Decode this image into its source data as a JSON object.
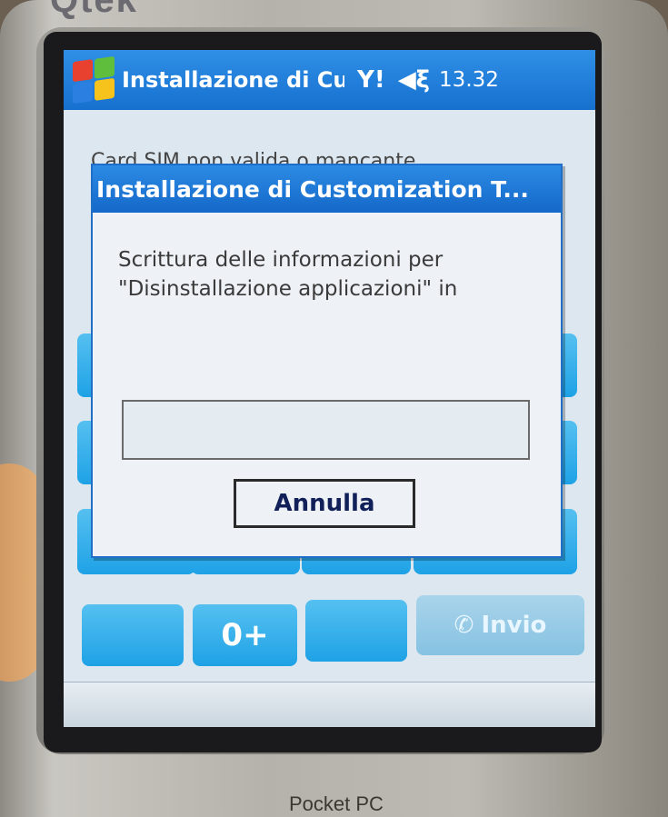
{
  "device": {
    "brand": "Qtek",
    "model_label": "Pocket PC"
  },
  "navbar": {
    "title": "Installazione di Cus",
    "signal_glyph": "Y!",
    "volume_glyph": "◀ξ",
    "clock": "13.32",
    "start_icon": "windows-flag-icon"
  },
  "background": {
    "partial_text": "Card SIM non valida o mancante"
  },
  "keypad": {
    "zero_key": "0+",
    "send_key": "Invio",
    "send_icon": "phone-handset-icon"
  },
  "dialog": {
    "title": "Installazione di Customization T...",
    "message": "Scrittura delle informazioni per \"Disinstallazione applicazioni\" in",
    "progress": 0,
    "cancel_label": "Annulla"
  },
  "colors": {
    "titlebar": "#1670cf",
    "key": "#1ea2e6",
    "screen_bg": "#dde7ef"
  }
}
